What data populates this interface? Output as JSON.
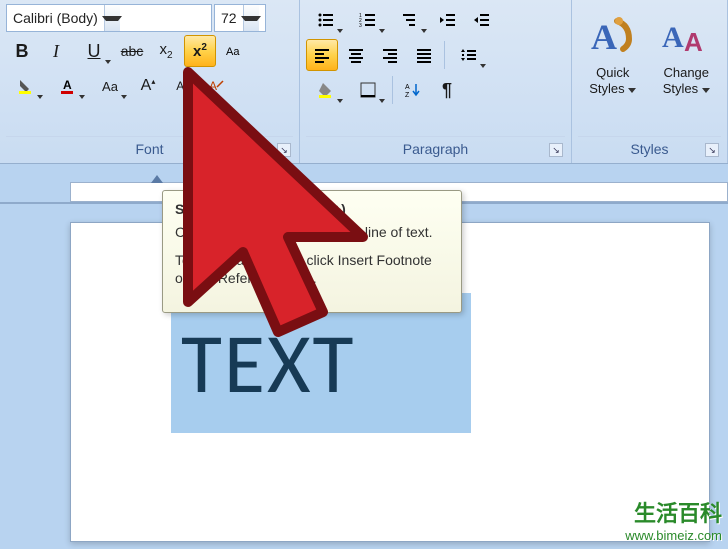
{
  "font": {
    "name": "Calibri (Body)",
    "size": "72",
    "group_label": "Font",
    "bold": "B",
    "italic": "I",
    "underline": "U",
    "strike": "abc",
    "subscript": "x₂",
    "superscript": "x²",
    "changecase": "Aa",
    "clearformat": "A",
    "grow": "A",
    "shrink": "A"
  },
  "paragraph": {
    "group_label": "Paragraph"
  },
  "styles": {
    "group_label": "Styles",
    "quick_label": "Quick Styles",
    "change_label": "Change Styles"
  },
  "tooltip": {
    "title": "Superscript (Ctrl+Shift++)",
    "line1": "Create small letters above the line of text.",
    "line2": "To create a footnote, click Insert Footnote on the References tab."
  },
  "document": {
    "text": "TEXT"
  },
  "watermark": {
    "brand": "生活百科",
    "url": "www.bimeiz.com"
  }
}
